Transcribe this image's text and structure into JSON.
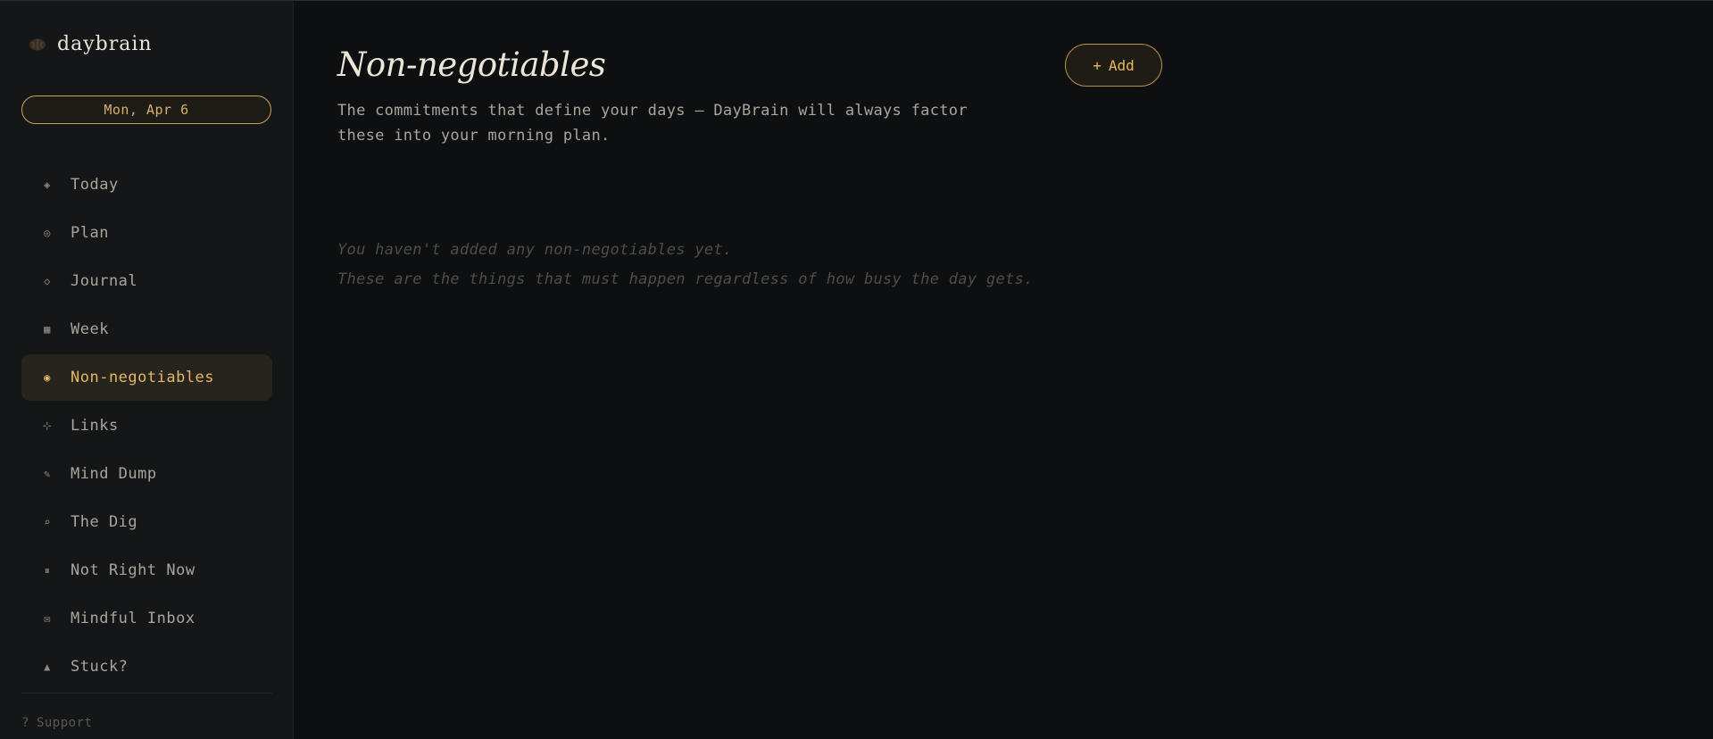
{
  "brand": {
    "name": "daybrain",
    "icon": "brain-icon"
  },
  "date_pill": "Mon, Apr 6",
  "sidebar": {
    "items": [
      {
        "label": "Today",
        "icon": "compass-diamond-icon",
        "glyph": "◈",
        "active": false
      },
      {
        "label": "Plan",
        "icon": "target-icon",
        "glyph": "◎",
        "active": false
      },
      {
        "label": "Journal",
        "icon": "diamond-outline-icon",
        "glyph": "◇",
        "active": false
      },
      {
        "label": "Week",
        "icon": "grid-calendar-icon",
        "glyph": "▦",
        "active": false
      },
      {
        "label": "Non-negotiables",
        "icon": "bullseye-icon",
        "glyph": "◉",
        "active": true
      },
      {
        "label": "Links",
        "icon": "sparkle-icon",
        "glyph": "⊹",
        "active": false
      },
      {
        "label": "Mind Dump",
        "icon": "pencil-icon",
        "glyph": "✎",
        "active": false
      },
      {
        "label": "The Dig",
        "icon": "magnifier-icon",
        "glyph": "⌕",
        "active": false
      },
      {
        "label": "Not Right Now",
        "icon": "pause-icon",
        "glyph": "⏸",
        "active": false
      },
      {
        "label": "Mindful Inbox",
        "icon": "envelope-icon",
        "glyph": "✉",
        "active": false
      },
      {
        "label": "Stuck?",
        "icon": "triangle-icon",
        "glyph": "▲",
        "active": false
      }
    ],
    "support": {
      "glyph": "?",
      "label": "Support"
    }
  },
  "main": {
    "title": "Non-negotiables",
    "description": "The commitments that define your days — DayBrain will always factor these into your morning plan.",
    "add_button": {
      "glyph": "+",
      "label": "Add"
    },
    "empty_state": {
      "line1": "You haven't added any non-negotiables yet.",
      "line2": "These are the things that must happen regardless of how busy the day gets."
    }
  },
  "colors": {
    "background": "#0d0f10",
    "sidebar": "#141617",
    "accent": "#e3b763",
    "active_bg": "#27241d"
  }
}
